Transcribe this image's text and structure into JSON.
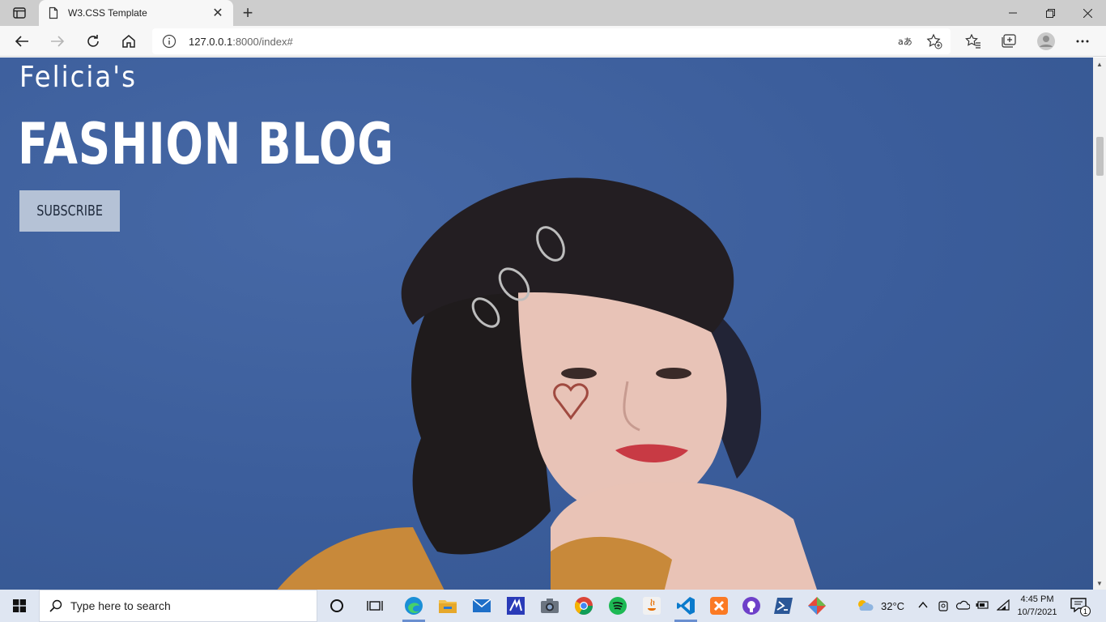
{
  "browser": {
    "tab_title": "W3.CSS Template",
    "url_host": "127.0.0.1",
    "url_rest": ":8000/index#"
  },
  "page": {
    "brand_top": "Felicia's",
    "brand_main": "FASHION BLOG",
    "subscribe_label": "SUBSCRIBE"
  },
  "taskbar": {
    "search_placeholder": "Type here to search",
    "weather": "32°C",
    "time": "4:45 PM",
    "date": "10/7/2021",
    "notification_count": "1"
  },
  "colors": {
    "hero_blue": "#3c5f9c",
    "subscribe_bg": "#b5c2d6",
    "taskbar_bg": "#dfe6f2"
  }
}
